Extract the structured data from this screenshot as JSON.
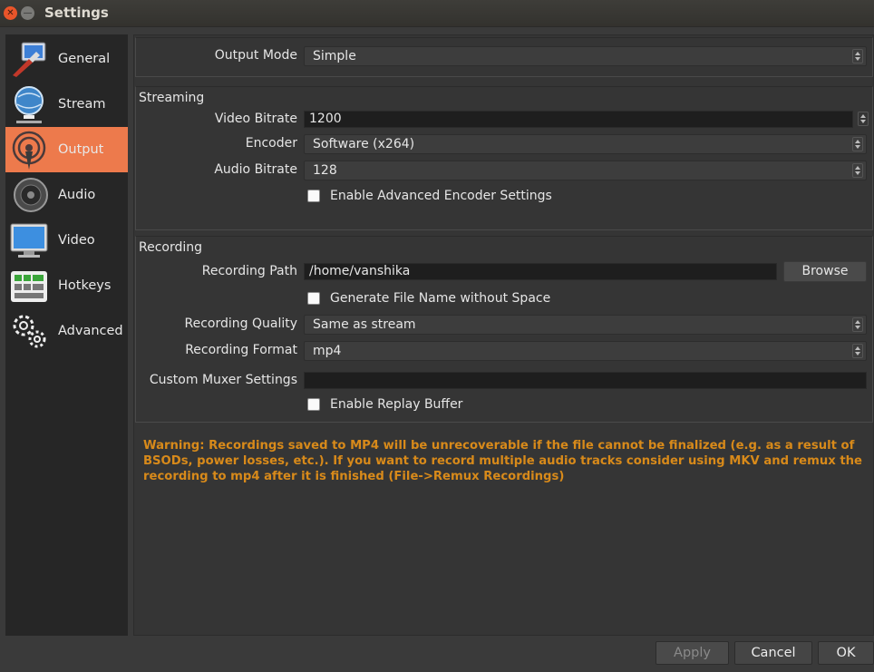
{
  "window": {
    "title": "Settings"
  },
  "sidebar": {
    "items": [
      {
        "label": "General",
        "icon": "general-icon"
      },
      {
        "label": "Stream",
        "icon": "stream-icon"
      },
      {
        "label": "Output",
        "icon": "output-icon",
        "active": true
      },
      {
        "label": "Audio",
        "icon": "audio-icon"
      },
      {
        "label": "Video",
        "icon": "video-icon"
      },
      {
        "label": "Hotkeys",
        "icon": "hotkeys-icon"
      },
      {
        "label": "Advanced",
        "icon": "advanced-icon"
      }
    ]
  },
  "output_mode": {
    "label": "Output Mode",
    "value": "Simple"
  },
  "streaming": {
    "title": "Streaming",
    "video_bitrate": {
      "label": "Video Bitrate",
      "value": "1200"
    },
    "encoder": {
      "label": "Encoder",
      "value": "Software (x264)"
    },
    "audio_bitrate": {
      "label": "Audio Bitrate",
      "value": "128"
    },
    "advanced_encoder": {
      "label": "Enable Advanced Encoder Settings",
      "checked": false
    }
  },
  "recording": {
    "title": "Recording",
    "path": {
      "label": "Recording Path",
      "value": "/home/vanshika",
      "browse_label": "Browse"
    },
    "no_space": {
      "label": "Generate File Name without Space",
      "checked": false
    },
    "quality": {
      "label": "Recording Quality",
      "value": "Same as stream"
    },
    "format": {
      "label": "Recording Format",
      "value": "mp4"
    },
    "muxer": {
      "label": "Custom Muxer Settings",
      "value": ""
    },
    "replay_buffer": {
      "label": "Enable Replay Buffer",
      "checked": false
    }
  },
  "warning": "Warning: Recordings saved to MP4 will be unrecoverable if the file cannot be finalized (e.g. as a result of BSODs, power losses, etc.). If you want to record multiple audio tracks consider using MKV and remux the recording to mp4 after it is finished (File->Remux Recordings)",
  "buttons": {
    "apply": "Apply",
    "cancel": "Cancel",
    "ok": "OK"
  },
  "colors": {
    "accent": "#ed7a4c",
    "warning": "#d88a1a"
  }
}
